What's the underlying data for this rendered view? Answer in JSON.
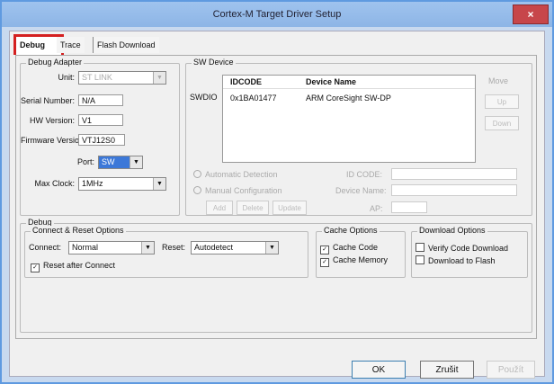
{
  "window": {
    "title": "Cortex-M Target Driver Setup",
    "close_label": "×"
  },
  "tabs": [
    {
      "label": "Debug"
    },
    {
      "label": "Trace"
    },
    {
      "label": "Flash Download"
    }
  ],
  "debug_adapter": {
    "group_label": "Debug Adapter",
    "unit_label": "Unit:",
    "unit_value": "ST LINK",
    "serial_label": "Serial Number:",
    "serial_value": "N/A",
    "hw_label": "HW Version:",
    "hw_value": "V1",
    "fw_label": "Firmware Version:",
    "fw_value": "VTJ12S0",
    "port_label": "Port:",
    "port_value": "SW",
    "maxclock_label": "Max Clock:",
    "maxclock_value": "1MHz"
  },
  "sw_device": {
    "group_label": "SW Device",
    "row_label": "SWDIO",
    "col_idcode": "IDCODE",
    "col_name": "Device Name",
    "rows": [
      {
        "idcode": "0x1BA01477",
        "name": "ARM CoreSight SW-DP"
      }
    ],
    "move_label": "Move",
    "up_label": "Up",
    "down_label": "Down",
    "auto_label": "Automatic Detection",
    "manual_label": "Manual Configuration",
    "idcode_label": "ID CODE:",
    "devname_label": "Device Name:",
    "apsel_label": "AP:",
    "add_label": "Add",
    "delete_label": "Delete",
    "update_label": "Update"
  },
  "debug": {
    "group_label": "Debug",
    "connect_group_label": "Connect & Reset Options",
    "connect_label": "Connect:",
    "connect_value": "Normal",
    "reset_label": "Reset:",
    "reset_value": "Autodetect",
    "reset_after_label": "Reset after Connect",
    "cache_group_label": "Cache Options",
    "cache_code_label": "Cache Code",
    "cache_memory_label": "Cache Memory",
    "download_group_label": "Download Options",
    "verify_label": "Verify Code Download",
    "download_flash_label": "Download to Flash"
  },
  "buttons": {
    "ok": "OK",
    "cancel": "Zrušit",
    "apply": "Použít"
  }
}
